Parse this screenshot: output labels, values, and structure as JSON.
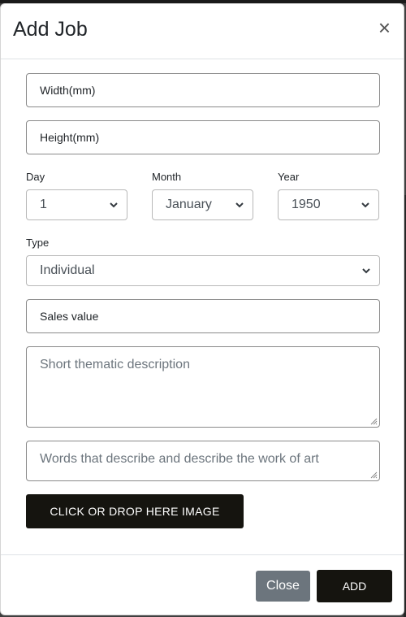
{
  "modal": {
    "title": "Add Job",
    "close_symbol": "×"
  },
  "form": {
    "width_placeholder": "Width(mm)",
    "height_placeholder": "Height(mm)",
    "day_label": "Day",
    "day_value": "1",
    "month_label": "Month",
    "month_value": "January",
    "year_label": "Year",
    "year_value": "1950",
    "type_label": "Type",
    "type_value": "Individual",
    "sales_placeholder": "Sales value",
    "description_placeholder": "Short thematic description",
    "keywords_placeholder": "Words that describe and describe the work of art",
    "upload_label": "CLICK OR DROP HERE IMAGE"
  },
  "footer": {
    "close_label": "Close",
    "add_label": "ADD"
  },
  "icons": {
    "close": "close-icon",
    "select_caret": "chevron-down-icon",
    "resize": "resize-handle-icon"
  },
  "colors": {
    "primary_dark": "#15140f",
    "secondary_gray": "#6c757d",
    "border": "#8a8a8a"
  }
}
